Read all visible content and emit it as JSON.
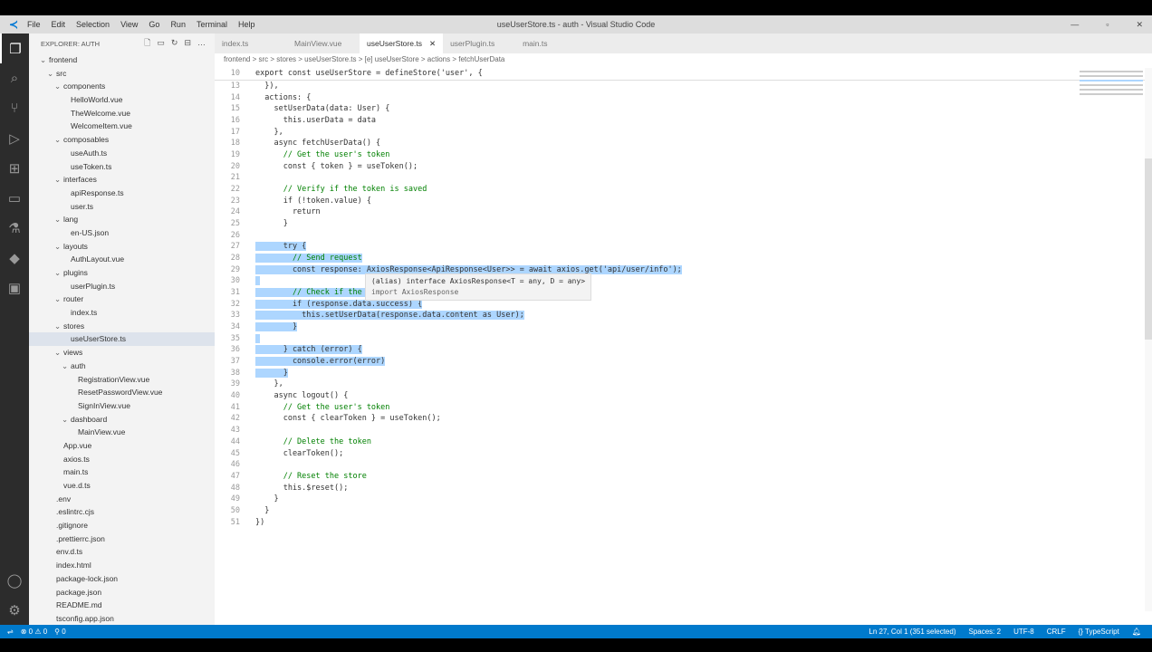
{
  "menu": [
    "File",
    "Edit",
    "Selection",
    "View",
    "Go",
    "Run",
    "Terminal",
    "Help"
  ],
  "window_title": "useUserStore.ts - auth - Visual Studio Code",
  "sidebar": {
    "title": "EXPLORER: AUTH",
    "tree": [
      {
        "d": 0,
        "f": true,
        "l": "frontend"
      },
      {
        "d": 1,
        "f": true,
        "l": "src"
      },
      {
        "d": 2,
        "f": true,
        "l": "components"
      },
      {
        "d": 3,
        "l": "HelloWorld.vue"
      },
      {
        "d": 3,
        "l": "TheWelcome.vue"
      },
      {
        "d": 3,
        "l": "WelcomeItem.vue"
      },
      {
        "d": 2,
        "f": true,
        "l": "composables"
      },
      {
        "d": 3,
        "l": "useAuth.ts"
      },
      {
        "d": 3,
        "l": "useToken.ts"
      },
      {
        "d": 2,
        "f": true,
        "l": "interfaces"
      },
      {
        "d": 3,
        "l": "apiResponse.ts"
      },
      {
        "d": 3,
        "l": "user.ts"
      },
      {
        "d": 2,
        "f": true,
        "l": "lang"
      },
      {
        "d": 3,
        "l": "en-US.json"
      },
      {
        "d": 2,
        "f": true,
        "l": "layouts"
      },
      {
        "d": 3,
        "l": "AuthLayout.vue"
      },
      {
        "d": 2,
        "f": true,
        "l": "plugins"
      },
      {
        "d": 3,
        "l": "userPlugin.ts"
      },
      {
        "d": 2,
        "f": true,
        "l": "router"
      },
      {
        "d": 3,
        "l": "index.ts"
      },
      {
        "d": 2,
        "f": true,
        "l": "stores"
      },
      {
        "d": 3,
        "l": "useUserStore.ts",
        "a": true
      },
      {
        "d": 2,
        "f": true,
        "l": "views"
      },
      {
        "d": 3,
        "f": true,
        "l": "auth"
      },
      {
        "d": 4,
        "l": "RegistrationView.vue"
      },
      {
        "d": 4,
        "l": "ResetPasswordView.vue"
      },
      {
        "d": 4,
        "l": "SignInView.vue"
      },
      {
        "d": 3,
        "f": true,
        "l": "dashboard"
      },
      {
        "d": 4,
        "l": "MainView.vue"
      },
      {
        "d": 2,
        "l": "App.vue"
      },
      {
        "d": 2,
        "l": "axios.ts"
      },
      {
        "d": 2,
        "l": "main.ts"
      },
      {
        "d": 2,
        "l": "vue.d.ts"
      },
      {
        "d": 1,
        "l": ".env"
      },
      {
        "d": 1,
        "l": ".eslintrc.cjs"
      },
      {
        "d": 1,
        "l": ".gitignore"
      },
      {
        "d": 1,
        "l": ".prettierrc.json"
      },
      {
        "d": 1,
        "l": "env.d.ts"
      },
      {
        "d": 1,
        "l": "index.html"
      },
      {
        "d": 1,
        "l": "package-lock.json"
      },
      {
        "d": 1,
        "l": "package.json"
      },
      {
        "d": 1,
        "l": "README.md"
      },
      {
        "d": 1,
        "l": "tsconfig.app.json"
      }
    ]
  },
  "tabs": [
    {
      "label": "index.ts"
    },
    {
      "label": "MainView.vue"
    },
    {
      "label": "useUserStore.ts",
      "active": true
    },
    {
      "label": "userPlugin.ts"
    },
    {
      "label": "main.ts"
    }
  ],
  "breadcrumb": "frontend > src > stores > useUserStore.ts > [e] useUserStore > actions > fetchUserData",
  "code": [
    {
      "n": 10,
      "t": "export const useUserStore = defineStore('user', {",
      "sticky": true
    },
    {
      "n": 13,
      "t": "  }),"
    },
    {
      "n": 14,
      "t": "  actions: {"
    },
    {
      "n": 15,
      "t": "    setUserData(data: User) {"
    },
    {
      "n": 16,
      "t": "      this.userData = data"
    },
    {
      "n": 17,
      "t": "    },"
    },
    {
      "n": 18,
      "t": "    async fetchUserData() {"
    },
    {
      "n": 19,
      "t": "      // Get the user's token",
      "c": 1
    },
    {
      "n": 20,
      "t": "      const { token } = useToken();"
    },
    {
      "n": 21,
      "t": ""
    },
    {
      "n": 22,
      "t": "      // Verify if the token is saved",
      "c": 1
    },
    {
      "n": 23,
      "t": "      if (!token.value) {"
    },
    {
      "n": 24,
      "t": "        return"
    },
    {
      "n": 25,
      "t": "      }"
    },
    {
      "n": 26,
      "t": ""
    },
    {
      "n": 27,
      "t": "      try {",
      "s": 1
    },
    {
      "n": 28,
      "t": "        // Send request",
      "s": 1,
      "c": 1
    },
    {
      "n": 29,
      "t": "        const response: AxiosResponse<ApiResponse<User>> = await axios.get('api/user/info');",
      "s": 1
    },
    {
      "n": 30,
      "t": " ",
      "s": 1
    },
    {
      "n": 31,
      "t": "        // Check if the message is success",
      "s": 1,
      "c": 1
    },
    {
      "n": 32,
      "t": "        if (response.data.success) {",
      "s": 1
    },
    {
      "n": 33,
      "t": "          this.setUserData(response.data.content as User);",
      "s": 1
    },
    {
      "n": 34,
      "t": "        }",
      "s": 1
    },
    {
      "n": 35,
      "t": " ",
      "s": 1
    },
    {
      "n": 36,
      "t": "      } catch (error) {",
      "s": 1
    },
    {
      "n": 37,
      "t": "        console.error(error)",
      "s": 1
    },
    {
      "n": 38,
      "t": "      }",
      "s": 1
    },
    {
      "n": 39,
      "t": "    },"
    },
    {
      "n": 40,
      "t": "    async logout() {"
    },
    {
      "n": 41,
      "t": "      // Get the user's token",
      "c": 1
    },
    {
      "n": 42,
      "t": "      const { clearToken } = useToken();"
    },
    {
      "n": 43,
      "t": ""
    },
    {
      "n": 44,
      "t": "      // Delete the token",
      "c": 1
    },
    {
      "n": 45,
      "t": "      clearToken();"
    },
    {
      "n": 46,
      "t": ""
    },
    {
      "n": 47,
      "t": "      // Reset the store",
      "c": 1
    },
    {
      "n": 48,
      "t": "      this.$reset();"
    },
    {
      "n": 49,
      "t": "    }"
    },
    {
      "n": 50,
      "t": "  }"
    },
    {
      "n": 51,
      "t": "})"
    }
  ],
  "hover": {
    "line1": "(alias) interface AxiosResponse<T = any, D = any>",
    "line2": "import AxiosResponse"
  },
  "status": {
    "errors": "0",
    "warnings": "0",
    "remote": "0",
    "position": "Ln 27, Col 1 (351 selected)",
    "spaces": "Spaces: 2",
    "encoding": "UTF-8",
    "eol": "CRLF",
    "language": "{} TypeScript"
  }
}
